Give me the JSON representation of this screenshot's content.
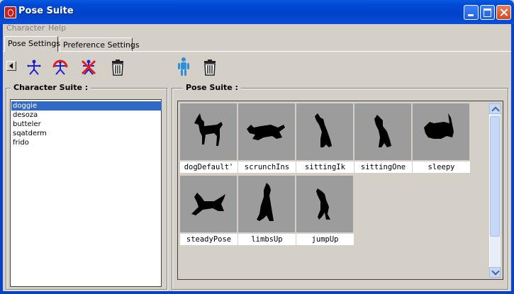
{
  "window": {
    "title": "Pose Suite"
  },
  "menu": {
    "items": [
      "Character",
      "Help"
    ]
  },
  "tabs": [
    {
      "label": "Pose Settings",
      "active": true
    },
    {
      "label": "Preference Settings",
      "active": false
    }
  ],
  "toolbar": {
    "left": [
      "add-character-icon",
      "edit-character-icon",
      "delete-character-icon",
      "trash-icon"
    ],
    "right": [
      "add-pose-icon",
      "trash-icon"
    ]
  },
  "character_suite": {
    "label": "Character Suite :",
    "items": [
      "doggie",
      "desoza",
      "butteler",
      "sqatderm",
      "frido"
    ],
    "selected": "doggie"
  },
  "pose_suite": {
    "label": "Pose Suite :",
    "poses": [
      {
        "name": "dogDefault'",
        "icon": "dog-standing-icon"
      },
      {
        "name": "scrunchIns",
        "icon": "dog-scrunch-icon"
      },
      {
        "name": "sittingIk",
        "icon": "dog-sitting-icon"
      },
      {
        "name": "sittingOne",
        "icon": "dog-sitting-icon"
      },
      {
        "name": "sleepy",
        "icon": "dog-sleepy-icon"
      },
      {
        "name": "steadyPose",
        "icon": "dog-lying-icon"
      },
      {
        "name": "limbsUp",
        "icon": "dog-sitting-up-icon"
      },
      {
        "name": "jumpUp",
        "icon": "dog-jump-icon"
      }
    ]
  },
  "colors": {
    "title_bar": "#0042c8",
    "selection": "#316ac5",
    "thumb_bg": "#9c9c9c",
    "window_bg": "#d4d0c8"
  }
}
